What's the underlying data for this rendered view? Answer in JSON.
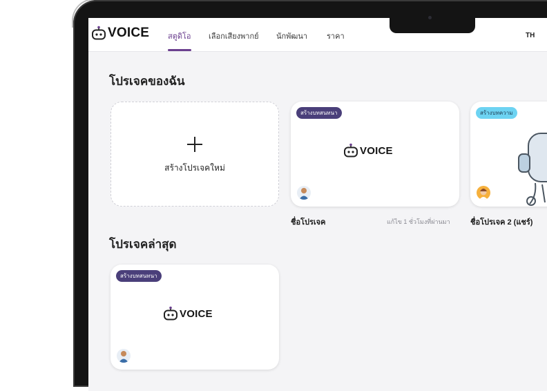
{
  "app": {
    "brand": "VOICE",
    "language": "TH"
  },
  "nav": {
    "tabs": [
      {
        "label": "สตูดิโอ",
        "active": true
      },
      {
        "label": "เลือกเสียงพากย์",
        "active": false
      },
      {
        "label": "นักพัฒนา",
        "active": false
      },
      {
        "label": "ราคา",
        "active": false
      }
    ]
  },
  "my_projects": {
    "title": "โปรเจคของฉัน",
    "new_project_label": "สร้างโปรเจคใหม่",
    "cards": [
      {
        "badge": "สร้างบทสนทนา",
        "name": "ชื่อโปรเจค",
        "meta": "แก้ไข 1 ชั่วโมงที่ผ่านมา"
      },
      {
        "badge": "สร้างบทความ",
        "name": "ชื่อโปรเจค 2 (แชร์)",
        "meta": ""
      }
    ]
  },
  "recent_projects": {
    "title": "โปรเจคล่าสุด",
    "cards": [
      {
        "badge": "สร้างบทสนทนา"
      }
    ]
  },
  "colors": {
    "accent": "#6b3f8f",
    "badge_dark": "#4a3f7a",
    "badge_cyan": "#6dd3f2"
  }
}
